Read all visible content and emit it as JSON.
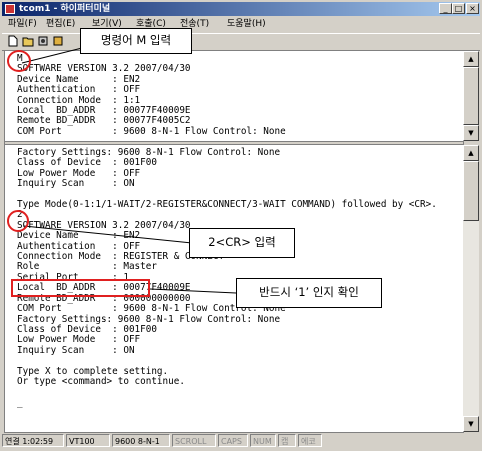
{
  "window": {
    "title": "tcom1 - 하이퍼터미널",
    "buttons": {
      "minimize": "_",
      "maximize": "□",
      "close": "×"
    }
  },
  "menu": [
    "파일(F)",
    "편집(E)",
    "보기(V)",
    "호출(C)",
    "전송(T)",
    "도움말(H)"
  ],
  "toolbar": {
    "icons": [
      "new-icon",
      "open-icon",
      "connect-icon",
      "disconnect-icon"
    ]
  },
  "terminal_top": [
    "M",
    "SOFTWARE VERSION 3.2 2007/04/30",
    "Device Name      : EN2",
    "Authentication   : OFF",
    "Connection Mode  : 1:1",
    "Local  BD_ADDR   : 00077F40009E",
    "Remote BD_ADDR   : 00077F4005C2",
    "COM Port         : 9600 8-N-1 Flow Control: None"
  ],
  "terminal_bottom": [
    "Factory Settings: 9600 8-N-1 Flow Control: None",
    "Class of Device  : 001F00",
    "Low Power Mode   : OFF",
    "Inquiry Scan     : ON",
    "",
    "Type Mode(0-1:1/1-WAIT/2-REGISTER&CONNECT/3-WAIT COMMAND) followed by <CR>.",
    "2",
    "SOFTWARE VERSION 3.2 2007/04/30",
    "Device Name      : EN2",
    "Authentication   : OFF",
    "Connection Mode  : REGISTER & CONNECT",
    "Role             : Master",
    "Serial Port      : 1",
    "Local  BD_ADDR   : 00077F40009E",
    "Remote BD_ADDR   : 000000000000",
    "COM Port         : 9600 8-N-1 Flow Control: None",
    "Factory Settings: 9600 8-N-1 Flow Control: None",
    "Class of Device  : 001F00",
    "Low Power Mode   : OFF",
    "Inquiry Scan     : ON",
    "",
    "Type X to complete setting.",
    "Or type <command> to continue.",
    "",
    "_"
  ],
  "status": {
    "connected": "연결 1:02:59",
    "emulation": "VT100",
    "port": "9600 8-N-1",
    "scroll": "SCROLL",
    "caps": "CAPS",
    "num": "NUM",
    "capture": "캡",
    "echo": "에코"
  },
  "annotations": {
    "command_m": "명령어  M  입력",
    "enter_2": "2<CR>  입력",
    "check_1": "반드시 ‘1’ 인지  확인"
  },
  "colors": {
    "annotation": "#e02020",
    "title_start": "#0a246a",
    "title_end": "#a6caf0"
  }
}
